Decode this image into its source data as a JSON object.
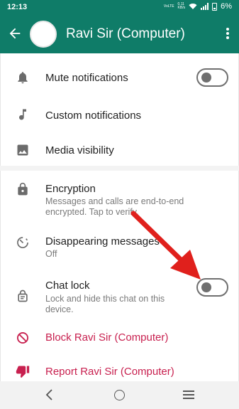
{
  "status_bar": {
    "time": "12:13",
    "net_top": "VoLTE",
    "net_speed": "0.11",
    "net_unit": "KB/s",
    "battery": "6%"
  },
  "header": {
    "title": "Ravi Sir (Computer)",
    "icons": [
      "back-arrow-icon",
      "avatar",
      "more-vert-icon"
    ]
  },
  "settings": {
    "mute": {
      "label": "Mute notifications",
      "enabled": false
    },
    "custom": {
      "label": "Custom notifications"
    },
    "media": {
      "label": "Media visibility"
    },
    "encryption": {
      "label": "Encryption",
      "sub": "Messages and calls are end-to-end encrypted. Tap to verify."
    },
    "disappearing": {
      "label": "Disappearing messages",
      "sub": "Off"
    },
    "chat_lock": {
      "label": "Chat lock",
      "sub": "Lock and hide this chat on this device.",
      "enabled": false
    },
    "block": {
      "label": "Block Ravi Sir (Computer)"
    },
    "report": {
      "label": "Report Ravi Sir (Computer)"
    }
  },
  "colors": {
    "header": "#0f7c68",
    "danger": "#c8204f",
    "annotation_arrow": "#e0201c"
  }
}
